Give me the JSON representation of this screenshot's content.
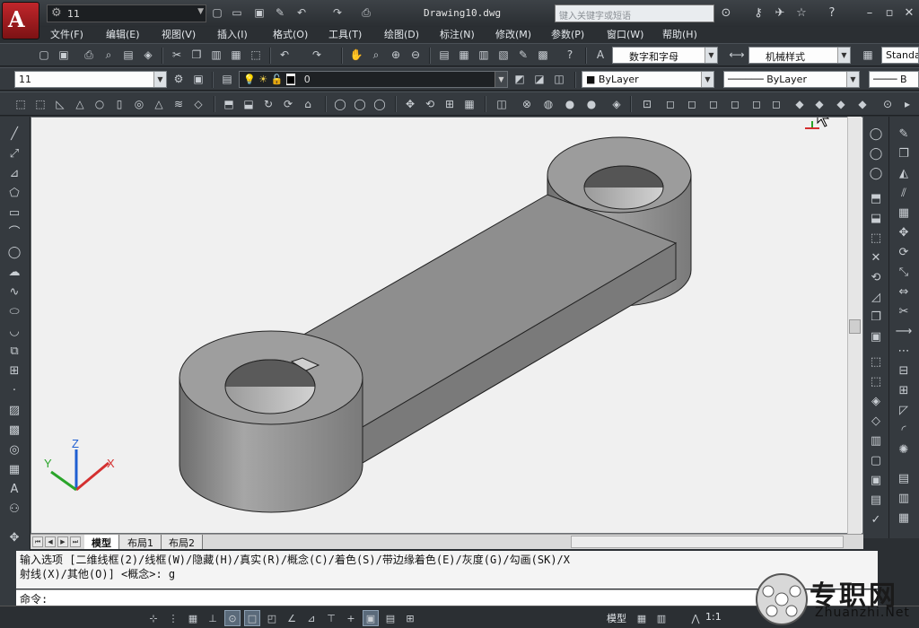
{
  "app": {
    "logo": "A",
    "title": "Drawing10.dwg"
  },
  "workspace": {
    "value": "11"
  },
  "search": {
    "placeholder": "键入关键字或短语"
  },
  "menu": [
    {
      "label": "文件(F)"
    },
    {
      "label": "编辑(E)"
    },
    {
      "label": "视图(V)"
    },
    {
      "label": "插入(I)"
    },
    {
      "label": "格式(O)"
    },
    {
      "label": "工具(T)"
    },
    {
      "label": "绘图(D)"
    },
    {
      "label": "标注(N)"
    },
    {
      "label": "修改(M)"
    },
    {
      "label": "参数(P)"
    },
    {
      "label": "窗口(W)"
    },
    {
      "label": "帮助(H)"
    }
  ],
  "styles": {
    "text_style": "数字和字母",
    "dim_style": "机械样式",
    "table_style": "Standa"
  },
  "layers": {
    "layer_combo": "11",
    "current_layer": "0"
  },
  "properties": {
    "color": "ByLayer",
    "linetype": "ByLayer",
    "lineweight": "B"
  },
  "tabs": [
    {
      "label": "模型"
    },
    {
      "label": "布局1"
    },
    {
      "label": "布局2"
    }
  ],
  "command": {
    "history_line1": "输入选项 [二维线框(2)/线框(W)/隐藏(H)/真实(R)/概念(C)/着色(S)/带边缘着色(E)/灰度(G)/勾画(SK)/X",
    "history_line2": "射线(X)/其他(O)] <概念>: g",
    "prompt": "命令:"
  },
  "status": {
    "space": "模型",
    "scale": "1:1"
  },
  "ucs": {
    "x": "X",
    "y": "Y",
    "z": "Z"
  },
  "watermark": {
    "main": "专职网",
    "sub": "Zhuanzhi.Net"
  },
  "colors": {
    "canvas": "#f0f0f0",
    "part_shade": "#8e8e8e",
    "accent_red": "#c0262b"
  }
}
